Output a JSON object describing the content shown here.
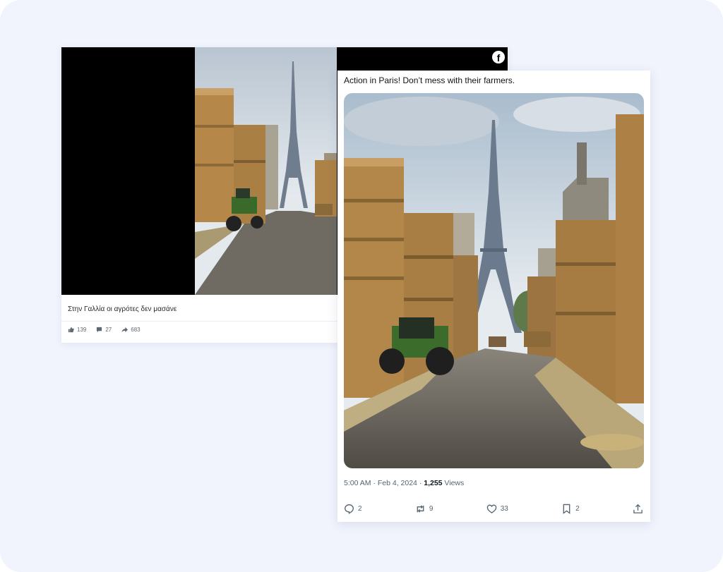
{
  "facebook_post": {
    "caption": "Στην Γαλλία οι αγρότες δεν μασάνε",
    "likes": "139",
    "comments": "27",
    "shares": "683",
    "logo_glyph": "f"
  },
  "x_post": {
    "text": "Action in Paris! Don’t mess with their farmers.",
    "time": "5:00 AM · Feb 4, 2024 · ",
    "views_count": "1,255",
    "views_label": " Views",
    "replies": "2",
    "reposts": "9",
    "likes": "33",
    "bookmarks": "2"
  },
  "colors": {
    "background": "#f1f4fd",
    "hay": "#b78b4c",
    "tractor": "#3f6b2a",
    "sky": "#cfdbe6"
  },
  "icons": [
    "facebook-icon",
    "like-icon",
    "comment-icon",
    "share-icon",
    "reply-icon",
    "repost-icon",
    "heart-icon",
    "bookmark-icon",
    "upload-icon"
  ]
}
